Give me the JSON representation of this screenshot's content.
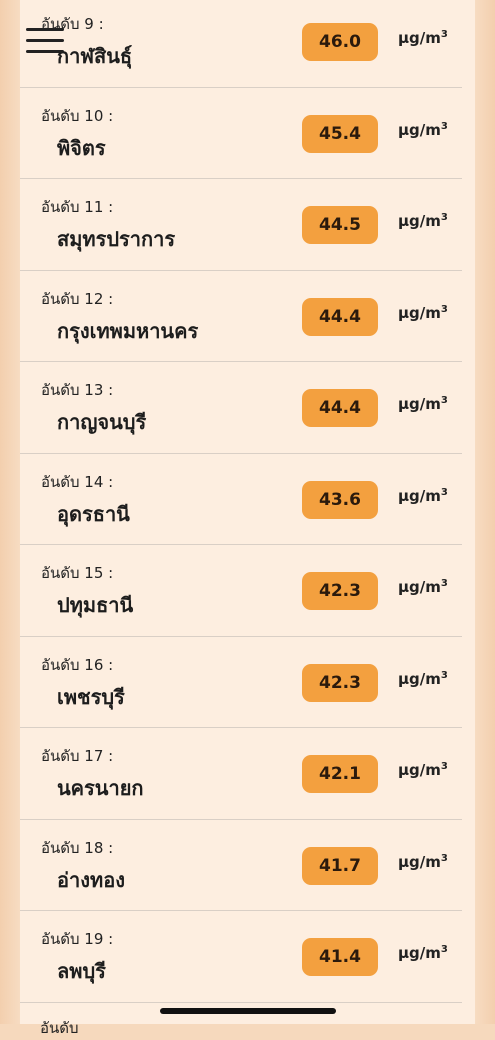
{
  "menu": {
    "icon": "hamburger-menu-icon"
  },
  "ranking": {
    "rank_prefix": "อันดับ",
    "unit_base": "μg/m",
    "unit_exp": "3",
    "items": [
      {
        "rank": "อันดับ 9 :",
        "province": "กาฬสินธุ์",
        "value": "46.0"
      },
      {
        "rank": "อันดับ 10 :",
        "province": "พิจิตร",
        "value": "45.4"
      },
      {
        "rank": "อันดับ 11 :",
        "province": "สมุทรปราการ",
        "value": "44.5"
      },
      {
        "rank": "อันดับ 12 :",
        "province": "กรุงเทพมหานคร",
        "value": "44.4"
      },
      {
        "rank": "อันดับ 13 :",
        "province": "กาญจนบุรี",
        "value": "44.4"
      },
      {
        "rank": "อันดับ 14 :",
        "province": "อุดรธานี",
        "value": "43.6"
      },
      {
        "rank": "อันดับ 15 :",
        "province": "ปทุมธานี",
        "value": "42.3"
      },
      {
        "rank": "อันดับ 16 :",
        "province": "เพชรบุรี",
        "value": "42.3"
      },
      {
        "rank": "อันดับ 17 :",
        "province": "นครนายก",
        "value": "42.1"
      },
      {
        "rank": "อันดับ 18 :",
        "province": "อ่างทอง",
        "value": "41.7"
      },
      {
        "rank": "อันดับ 19 :",
        "province": "ลพบุรี",
        "value": "41.4"
      }
    ]
  },
  "colors": {
    "badge": "#f3a03f",
    "panel": "#fdeee0",
    "background": "#f6d9bd"
  }
}
